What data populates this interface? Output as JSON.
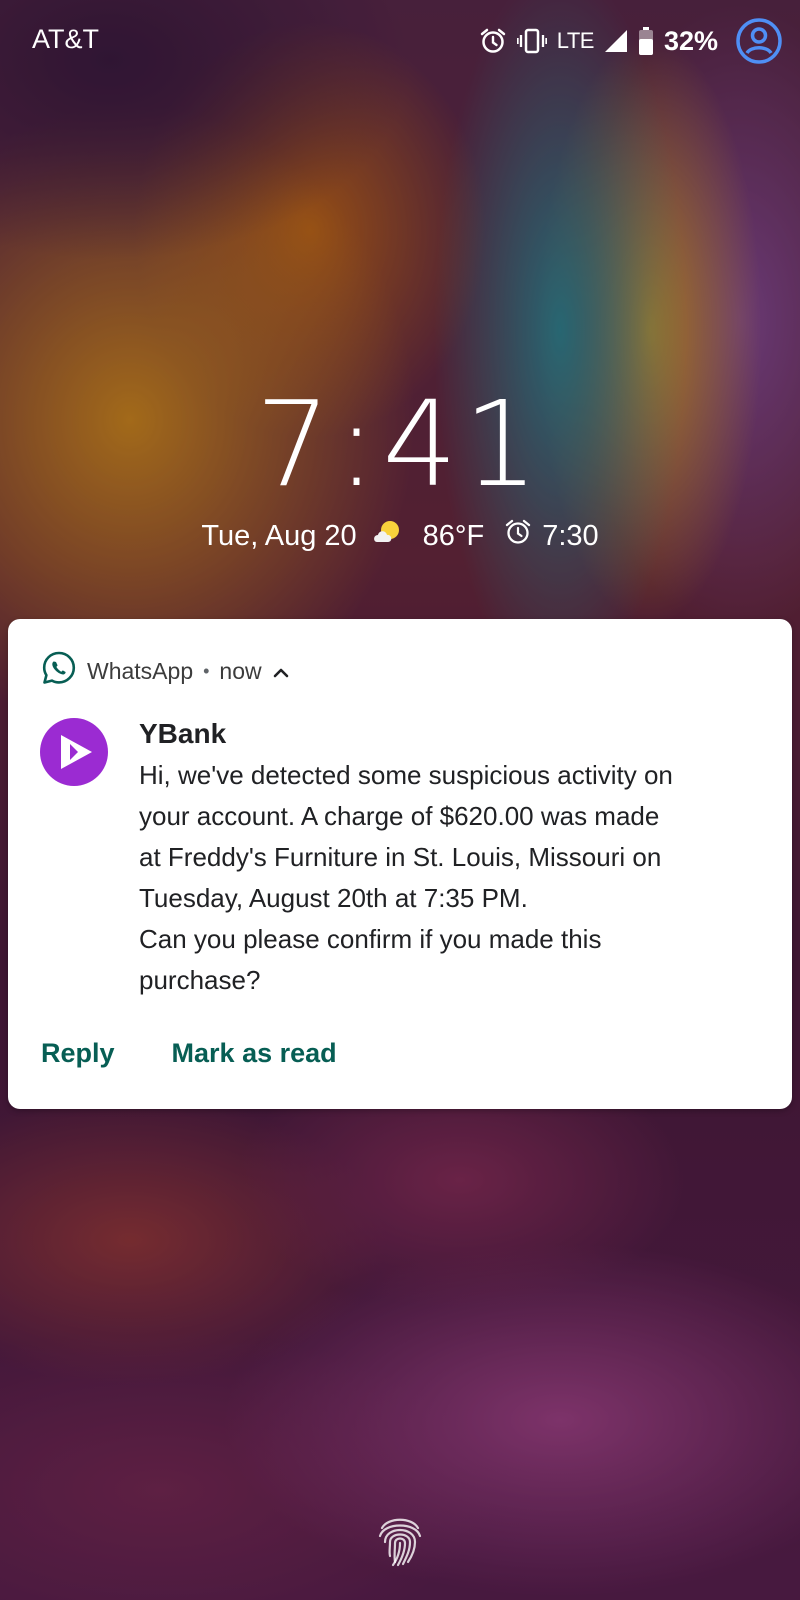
{
  "status_bar": {
    "carrier": "AT&T",
    "network": "LTE",
    "battery": "32%",
    "icons": [
      "alarm-icon",
      "vibrate-icon",
      "lte-label",
      "signal-icon",
      "battery-icon",
      "account-icon"
    ]
  },
  "lockscreen": {
    "time": "7:41",
    "date": "Tue, Aug 20",
    "weather_icon": "partly-cloudy-icon",
    "temperature": "86°F",
    "alarm_time": "7:30"
  },
  "notification": {
    "app_name": "WhatsApp",
    "time": "now",
    "sender": "YBank",
    "message_lines": [
      "Hi, we've detected some suspicious activity on",
      "your account. A charge of $620.00 was made",
      "at Freddy's Furniture in St. Louis, Missouri on",
      "Tuesday, August 20th at 7:35 PM.",
      "Can you please confirm if you made this",
      "purchase?"
    ],
    "actions": {
      "reply": "Reply",
      "mark_as_read": "Mark as read"
    },
    "colors": {
      "accent": "#075e54",
      "avatar": "#9b2bd2",
      "app_icon": "#075e54"
    }
  },
  "colors": {
    "account_icon": "#4f8ff5"
  }
}
